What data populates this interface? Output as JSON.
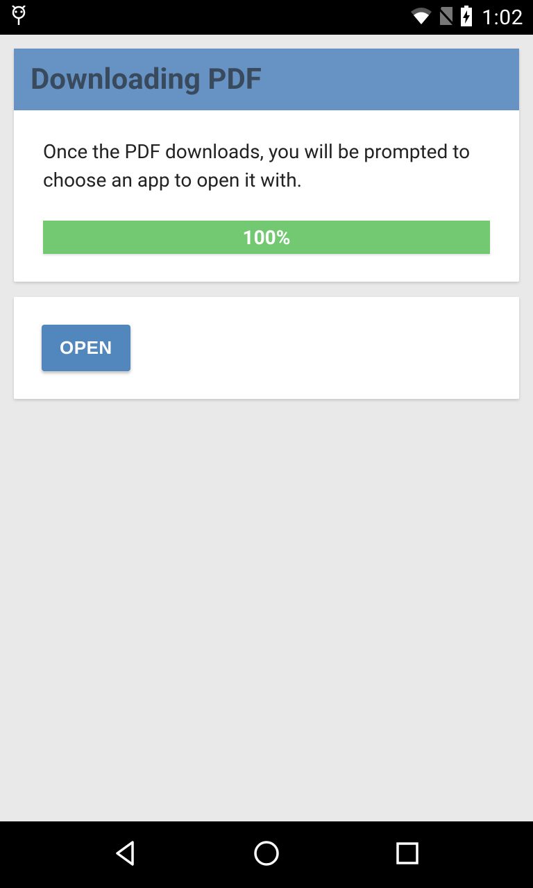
{
  "status_bar": {
    "time": "1:02"
  },
  "download_card": {
    "title": "Downloading PDF",
    "message": "Once the PDF downloads, you will be prompted to choose an app to open it with.",
    "progress_label": "100%",
    "progress_percent": 100
  },
  "open_card": {
    "open_label": "OPEN"
  },
  "colors": {
    "header_bg": "#6693c3",
    "header_text": "#3a4a5d",
    "progress_bg": "#72c972",
    "button_bg": "#5287bd",
    "page_bg": "#e9e9e9"
  }
}
